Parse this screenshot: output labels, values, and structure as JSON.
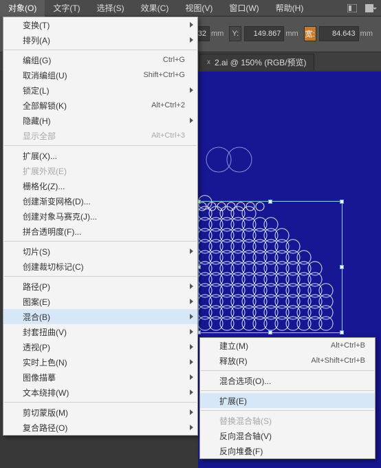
{
  "menubar": {
    "items": [
      "对象(O)",
      "文字(T)",
      "选择(S)",
      "效果(C)",
      "视图(V)",
      "窗口(W)",
      "帮助(H)"
    ]
  },
  "toolbar": {
    "x_unit": "mm",
    "y_value": "149.867",
    "y_unit": "mm",
    "w_value": "84.643",
    "w_unit": "mm",
    "x_value": "32",
    "y_label": "Y:",
    "w_label": "宽:"
  },
  "tab": {
    "title": "2.ai @ 150% (RGB/预览)",
    "close": "x"
  },
  "menu": {
    "groups": [
      [
        {
          "l": "变换(T)",
          "sub": true
        },
        {
          "l": "排列(A)",
          "sub": true
        }
      ],
      [
        {
          "l": "编组(G)",
          "sc": "Ctrl+G"
        },
        {
          "l": "取消编组(U)",
          "sc": "Shift+Ctrl+G"
        },
        {
          "l": "锁定(L)",
          "sub": true
        },
        {
          "l": "全部解锁(K)",
          "sc": "Alt+Ctrl+2"
        },
        {
          "l": "隐藏(H)",
          "sub": true
        },
        {
          "l": "显示全部",
          "sc": "Alt+Ctrl+3",
          "dis": true
        }
      ],
      [
        {
          "l": "扩展(X)..."
        },
        {
          "l": "扩展外观(E)",
          "dis": true
        },
        {
          "l": "栅格化(Z)..."
        },
        {
          "l": "创建渐变网格(D)..."
        },
        {
          "l": "创建对象马赛克(J)..."
        },
        {
          "l": "拼合透明度(F)..."
        }
      ],
      [
        {
          "l": "切片(S)",
          "sub": true
        },
        {
          "l": "创建裁切标记(C)"
        }
      ],
      [
        {
          "l": "路径(P)",
          "sub": true
        },
        {
          "l": "图案(E)",
          "sub": true
        },
        {
          "l": "混合(B)",
          "sub": true,
          "hot": true
        },
        {
          "l": "封套扭曲(V)",
          "sub": true
        },
        {
          "l": "透视(P)",
          "sub": true
        },
        {
          "l": "实时上色(N)",
          "sub": true
        },
        {
          "l": "图像描摹",
          "sub": true
        },
        {
          "l": "文本绕排(W)",
          "sub": true
        }
      ],
      [
        {
          "l": "剪切蒙版(M)",
          "sub": true
        },
        {
          "l": "复合路径(O)",
          "sub": true
        }
      ]
    ]
  },
  "submenu": {
    "groups": [
      [
        {
          "l": "建立(M)",
          "sc": "Alt+Ctrl+B"
        },
        {
          "l": "释放(R)",
          "sc": "Alt+Shift+Ctrl+B"
        }
      ],
      [
        {
          "l": "混合选项(O)..."
        }
      ],
      [
        {
          "l": "扩展(E)",
          "hot": true
        }
      ],
      [
        {
          "l": "替换混合轴(S)",
          "dis": true
        },
        {
          "l": "反向混合轴(V)"
        },
        {
          "l": "反向堆叠(F)"
        }
      ]
    ]
  }
}
